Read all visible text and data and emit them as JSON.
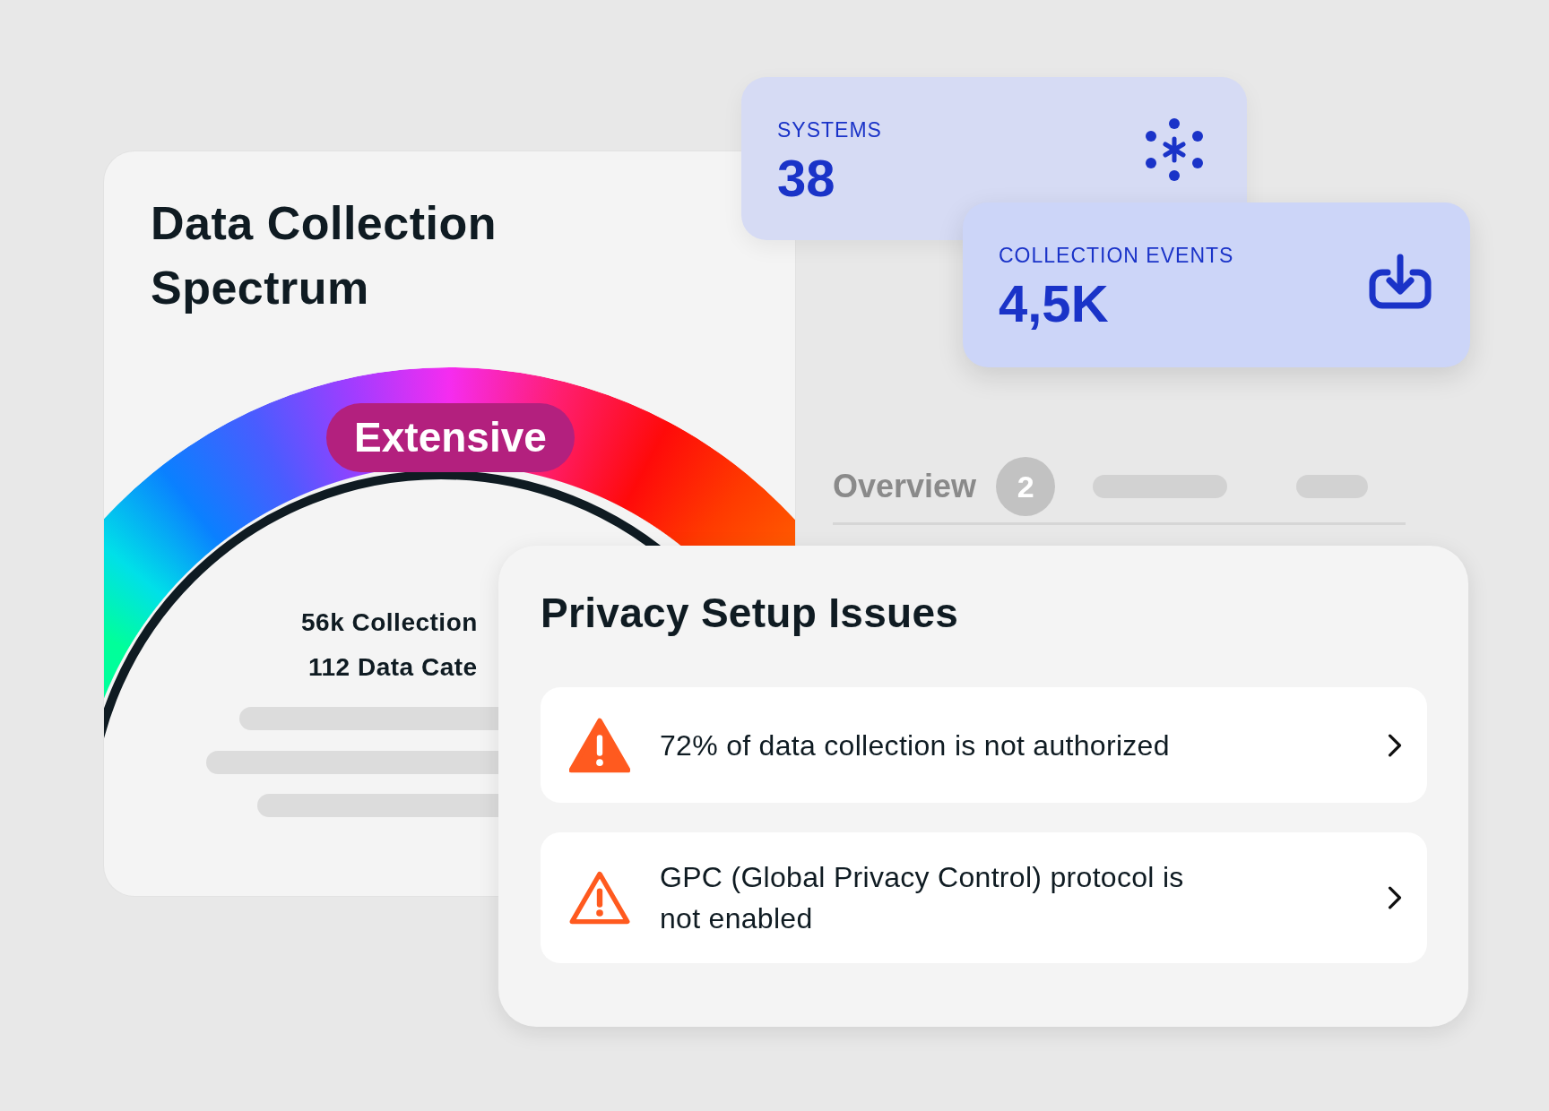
{
  "spectrum_card": {
    "title": "Data Collection Spectrum",
    "level_label": "Extensive",
    "stats": [
      "56k Collection",
      "112 Data Cate"
    ]
  },
  "stat_cards": [
    {
      "label": "SYSTEMS",
      "value": "38",
      "kind": "nodes"
    },
    {
      "label": "COLLECTION EVENTS",
      "value": "4,5K",
      "kind": "download"
    }
  ],
  "tab": {
    "label": "Overview",
    "badge": "2"
  },
  "issues": {
    "title": "Privacy Setup Issues",
    "items": [
      {
        "text": "72% of data collection is not authorized",
        "kind": "filled"
      },
      {
        "text": "GPC (Global Privacy Control) protocol is not enabled",
        "kind": "outline"
      }
    ]
  }
}
